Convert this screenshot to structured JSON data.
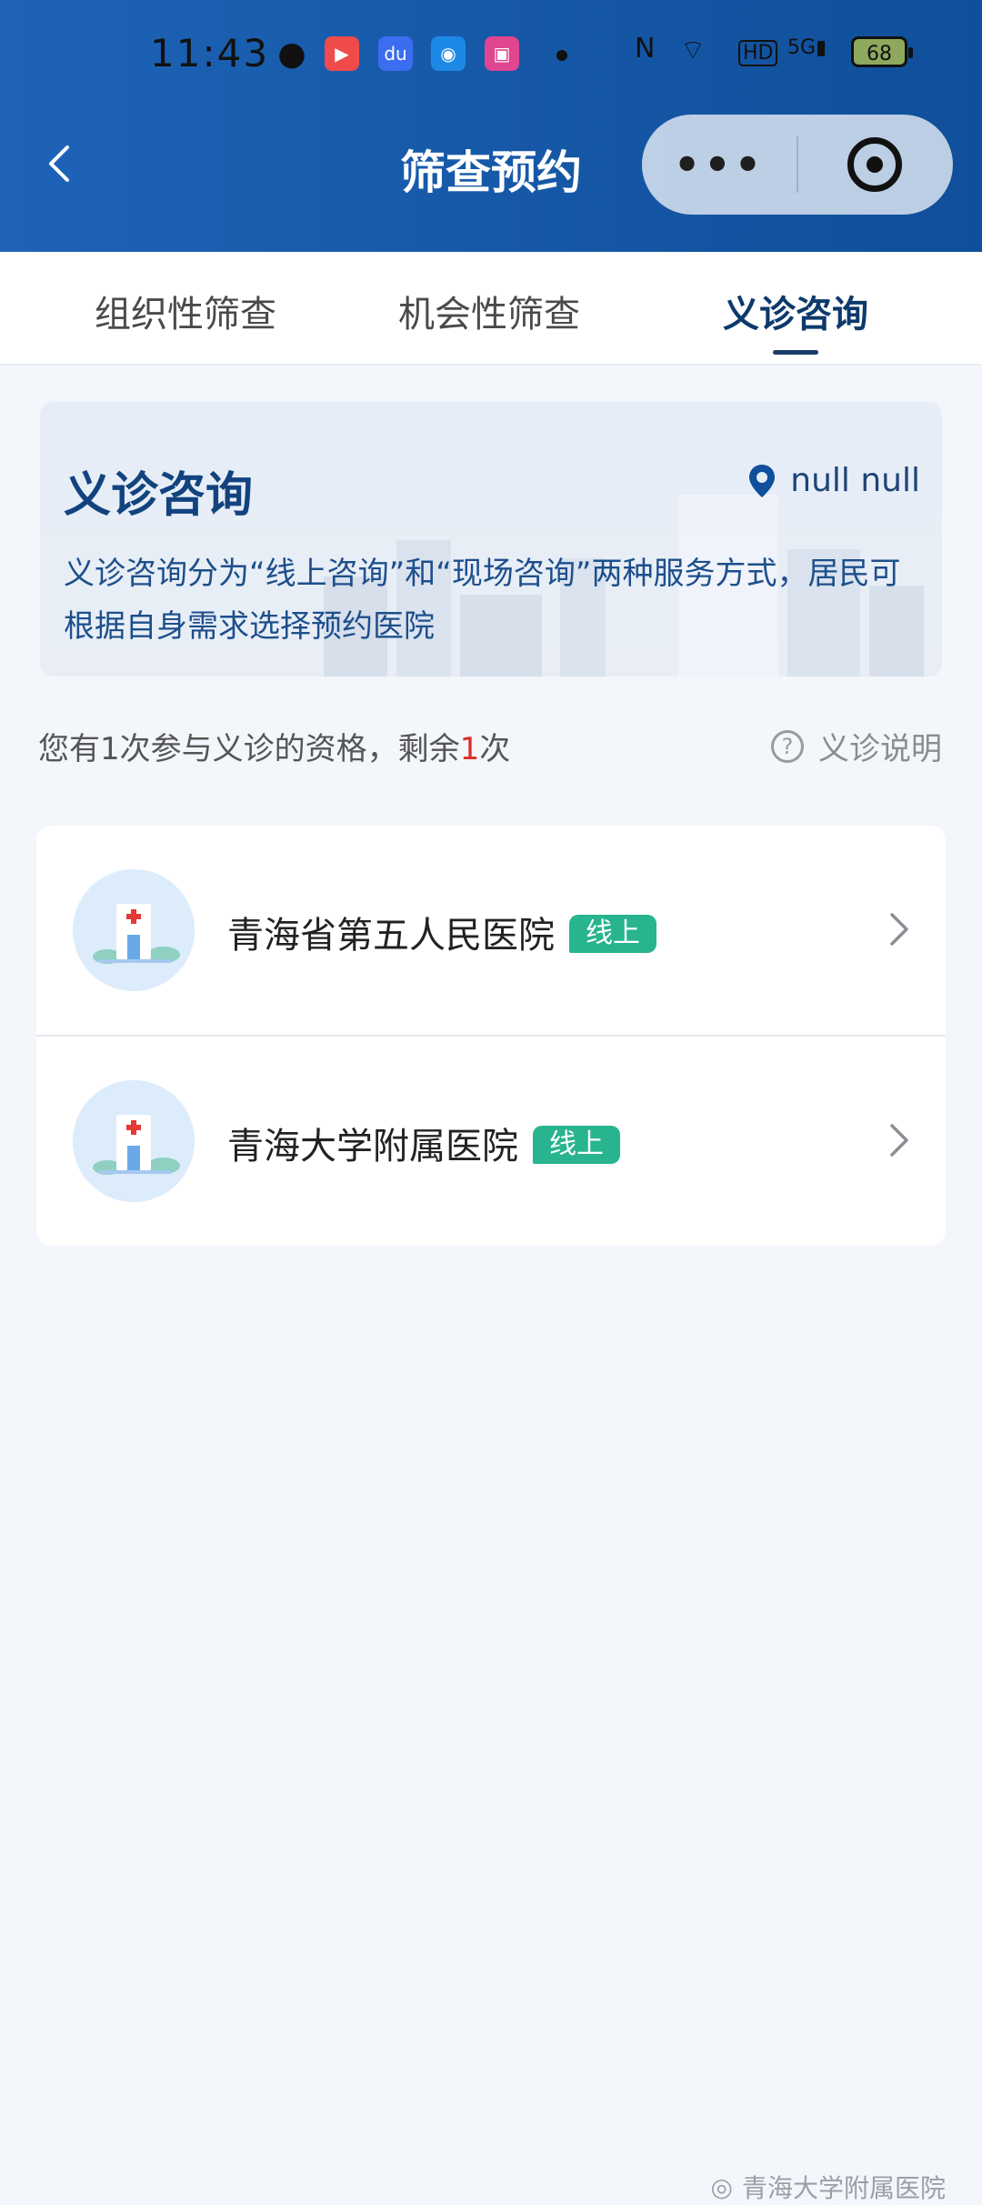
{
  "status_bar": {
    "time": "11:43",
    "network": "5G",
    "battery": "68"
  },
  "nav": {
    "title": "筛查预约",
    "more": "•••"
  },
  "tabs": [
    {
      "label": "组织性筛查"
    },
    {
      "label": "机会性筛查"
    },
    {
      "label": "义诊咨询",
      "active": true
    }
  ],
  "info_card": {
    "title": "义诊咨询",
    "location": "null null",
    "description": "义诊咨询分为“线上咨询”和“现场咨询”两种服务方式，居民可根据自身需求选择预约医院"
  },
  "eligibility": {
    "prefix": "您有1次参与义诊的资格，剩余",
    "remaining": "1",
    "suffix": "次",
    "help_label": "义诊说明"
  },
  "hospitals": [
    {
      "name": "青海省第五人民医院",
      "tag": "线上"
    },
    {
      "name": "青海大学附属医院",
      "tag": "线上"
    }
  ],
  "watermark": "青海大学附属医院",
  "colors": {
    "header": "#175aa9",
    "accent": "#0d3a6b",
    "badge": "#27b48e",
    "highlight": "#d93025"
  }
}
